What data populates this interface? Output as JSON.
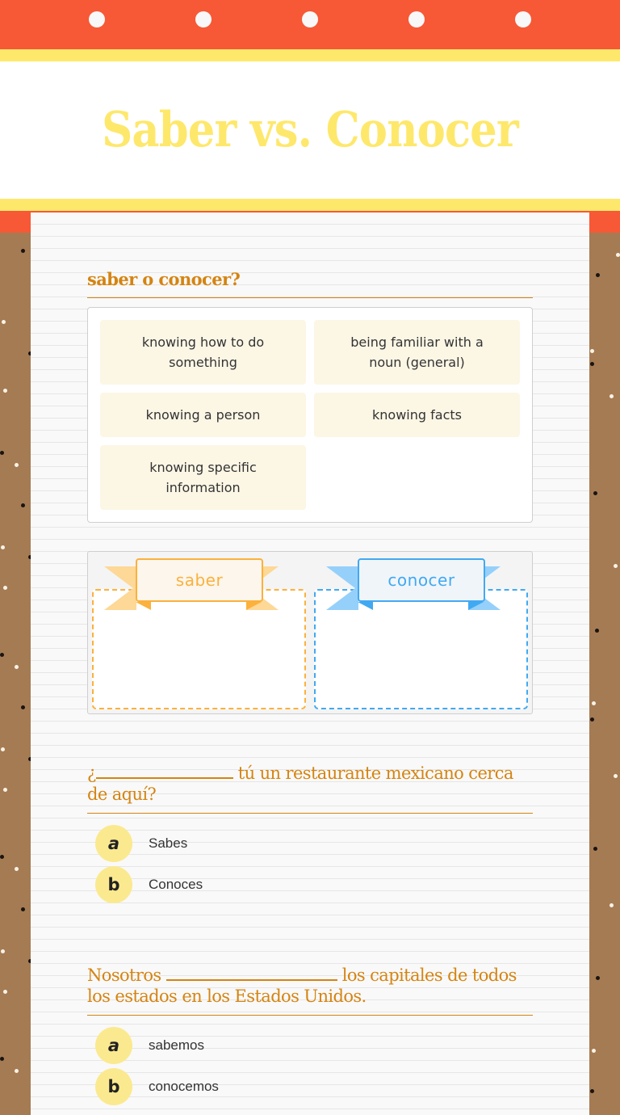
{
  "header": {
    "title": "Saber vs. Conocer",
    "colors": {
      "band": "#f75836",
      "accent": "#fee86c",
      "heading": "#d58411"
    }
  },
  "sections": {
    "sort": {
      "heading": "saber o conocer?",
      "cards": [
        {
          "label": "knowing how to do something"
        },
        {
          "label": "being familiar with a noun (general)"
        },
        {
          "label": "knowing a person"
        },
        {
          "label": "knowing facts"
        },
        {
          "label": "knowing specific information"
        }
      ],
      "categories": [
        {
          "label": "saber",
          "color": "#fbb13c"
        },
        {
          "label": "conocer",
          "color": "#41a9f1"
        }
      ]
    },
    "questions": [
      {
        "prefix": "¿",
        "suffix": " tú un restaurante mexicano cerca de aquí?",
        "options": [
          {
            "letter": "a",
            "label": "Sabes"
          },
          {
            "letter": "b",
            "label": "Conoces"
          }
        ]
      },
      {
        "prefix": "Nosotros ",
        "suffix": " los capitales de todos los estados en los Estados Unidos.",
        "options": [
          {
            "letter": "a",
            "label": "sabemos"
          },
          {
            "letter": "b",
            "label": "conocemos"
          }
        ]
      }
    ]
  }
}
